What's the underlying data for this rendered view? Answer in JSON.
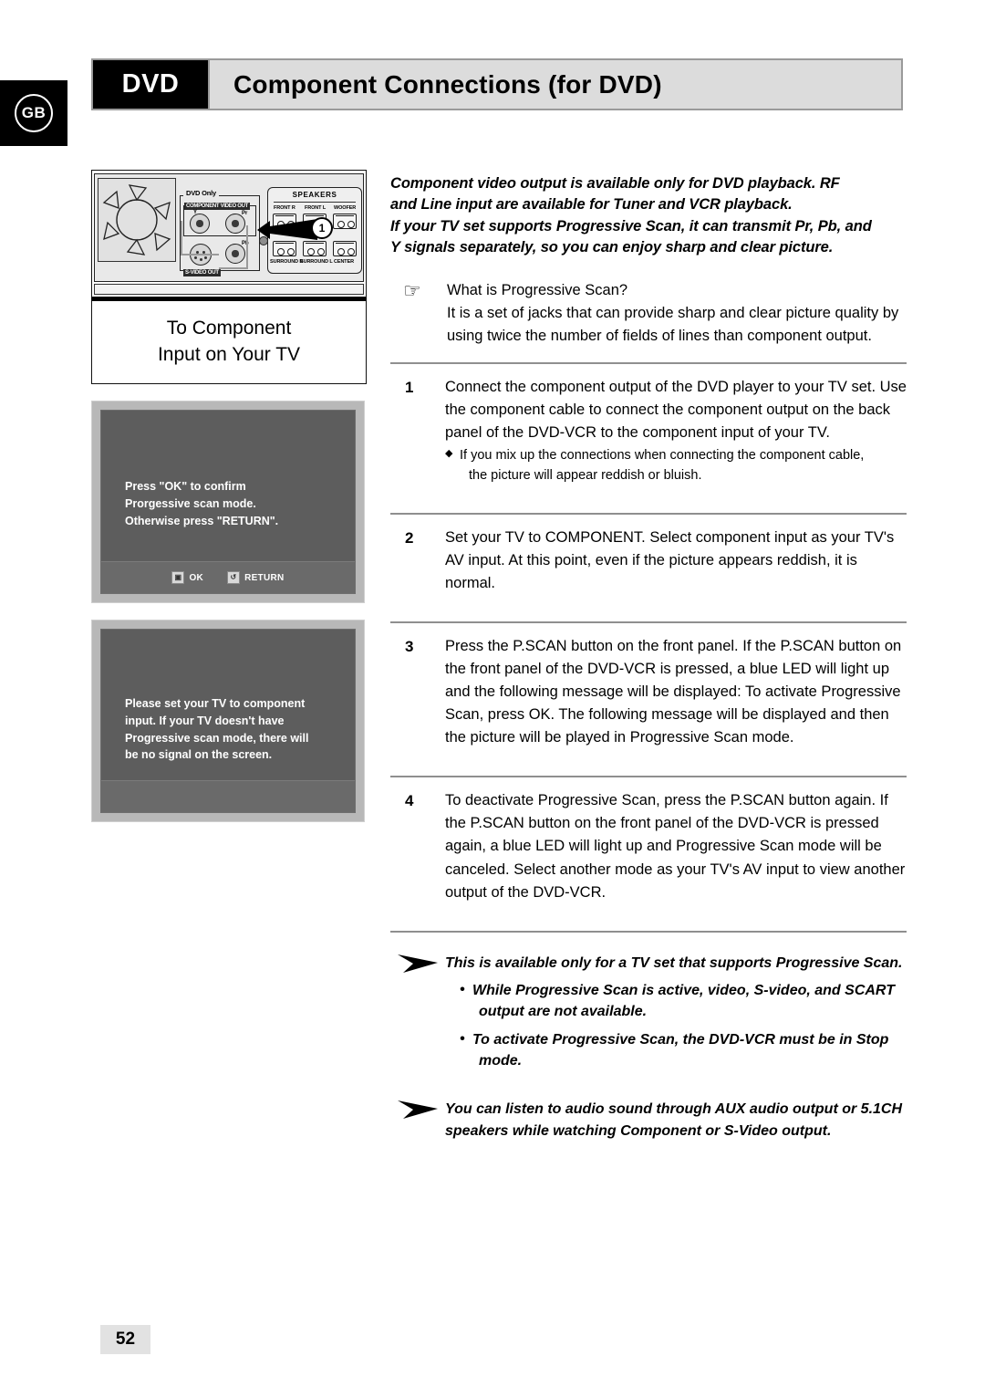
{
  "language_badge": "GB",
  "header": {
    "tag": "DVD",
    "title": "Component Connections (for DVD)"
  },
  "diagram": {
    "dvd_only_label": "DVD Only",
    "component_video_out_label": "COMPONENT VIDEO OUT",
    "jack_y": "Y",
    "jack_pr": "Pr",
    "jack_pb": "Pb",
    "s_video_out_label": "S-VIDEO OUT",
    "speakers_title": "SPEAKERS",
    "terminals": {
      "front_r": "FRONT R",
      "front_l": "FRONT L",
      "woofer": "WOOFER",
      "surround_r": "SURROUND R",
      "surround_l": "SURROUND L",
      "center": "CENTER"
    },
    "callout": "1"
  },
  "caption": {
    "line1": "To Component",
    "line2": "Input on Your TV"
  },
  "tv_screens": [
    {
      "lines": [
        "Press \"OK\" to confirm",
        "Prorgessive scan mode.",
        "Otherwise press \"RETURN\"."
      ],
      "buttons": [
        {
          "icon": "ok-icon",
          "glyph": "▣",
          "label": "OK"
        },
        {
          "icon": "return-icon",
          "glyph": "↺",
          "label": "RETURN"
        }
      ]
    },
    {
      "lines": [
        "Please set your TV to component",
        "input. If your TV doesn't have",
        "Progressive scan mode, there will",
        "be no signal on the screen."
      ],
      "buttons": []
    }
  ],
  "intro": {
    "line1": "Component video output is available only for DVD playback. RF",
    "line2": "and Line input are available for Tuner and VCR playback.",
    "line3": "If your TV set supports Progressive Scan, it can transmit Pr, Pb, and",
    "line4": "Y signals separately, so you can enjoy sharp and clear picture."
  },
  "progressive_note": {
    "icon": "pointing-hand-icon",
    "heading": "What is Progressive Scan?",
    "body": "It is a set of jacks that can provide sharp and clear picture quality by using twice the number of fields of lines than component output."
  },
  "steps": [
    {
      "number": "1",
      "text": "Connect the component output of the DVD player to your TV set. Use the component cable to connect the component output on the back panel of the DVD-VCR to the component input of your TV.",
      "sub": "If you mix up the connections when connecting the component cable,",
      "sub_cont": "the picture will appear reddish or bluish."
    },
    {
      "number": "2",
      "text": "Set your TV to COMPONENT. Select component input as your TV's AV input. At this point, even if the picture appears reddish, it is normal.",
      "sub": "",
      "sub_cont": ""
    },
    {
      "number": "3",
      "text": "Press the P.SCAN button on the front panel. If the P.SCAN button on the front panel of the DVD-VCR is pressed, a blue LED will light up and the following message will be displayed: To activate Progressive Scan, press OK. The following message will be displayed and then the picture will be played in Progressive Scan mode.",
      "sub": "",
      "sub_cont": ""
    },
    {
      "number": "4",
      "text": "To deactivate Progressive Scan, press the P.SCAN button again. If the P.SCAN button on the front panel of the DVD-VCR is pressed again, a blue LED will light up and Progressive Scan mode will be canceled. Select another mode as your TV's AV input to view another output of the DVD-VCR.",
      "sub": "",
      "sub_cont": ""
    }
  ],
  "tips": [
    {
      "icon": "arrow-bullet-icon",
      "text": "This is available only for a TV set that supports Progressive Scan.",
      "bullets": [
        {
          "text": "While Progressive Scan is active, video, S-video, and SCART",
          "cont": "output are not available."
        },
        {
          "text": "To activate Progressive Scan, the DVD-VCR must be in Stop",
          "cont": "mode."
        }
      ]
    },
    {
      "icon": "arrow-bullet-icon",
      "text": "You can listen to audio sound through AUX audio output or 5.1CH speakers while watching Component or S-Video output.",
      "bullets": []
    }
  ],
  "page_number": "52"
}
